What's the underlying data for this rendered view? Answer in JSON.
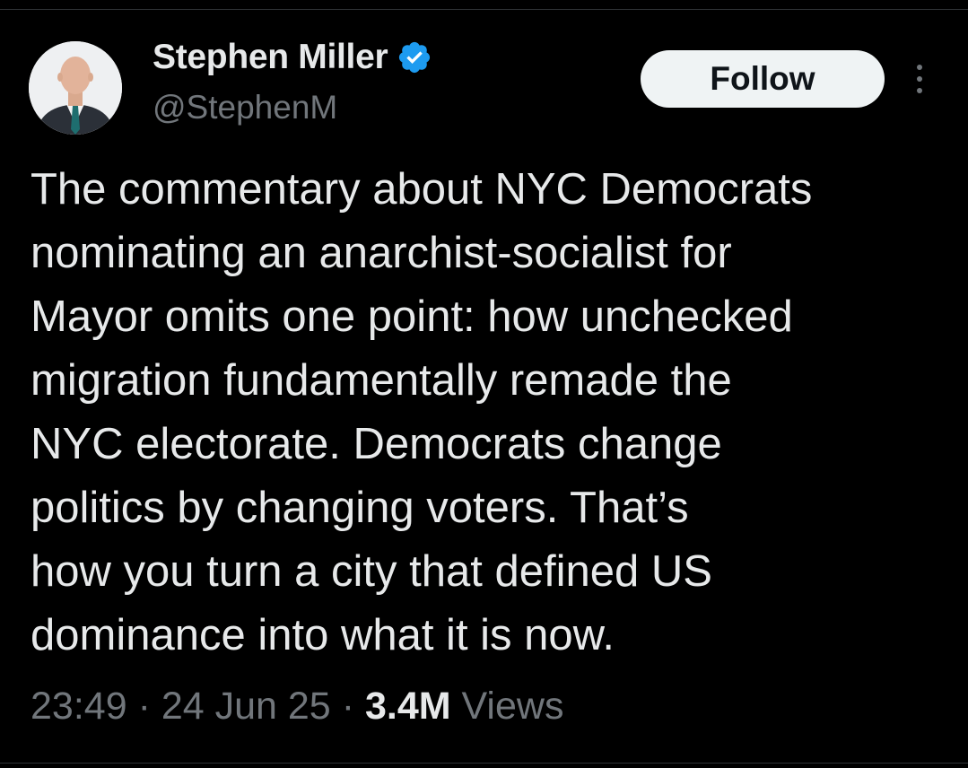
{
  "author": {
    "display_name": "Stephen Miller",
    "handle": "@StephenM",
    "verified": true,
    "avatar_icon": "profile-photo"
  },
  "actions": {
    "follow_label": "Follow",
    "more_icon": "more-vertical-icon"
  },
  "tweet": {
    "lines": [
      "The commentary about NYC Democrats",
      "nominating an anarchist-socialist for",
      "Mayor omits one point: how unchecked",
      "migration fundamentally remade the",
      "NYC electorate. Democrats change",
      "politics by changing voters. That’s",
      "how you turn a city that defined US",
      "dominance into what it is now."
    ]
  },
  "meta": {
    "time": "23:49",
    "separator": "·",
    "date": "24 Jun 25",
    "views_count": "3.4M",
    "views_label": "Views"
  },
  "colors": {
    "background": "#000000",
    "text_primary": "#e7e9ea",
    "text_secondary": "#71767b",
    "verified_blue": "#1d9bf0",
    "follow_bg": "#eff3f4",
    "follow_text": "#0f1419"
  }
}
